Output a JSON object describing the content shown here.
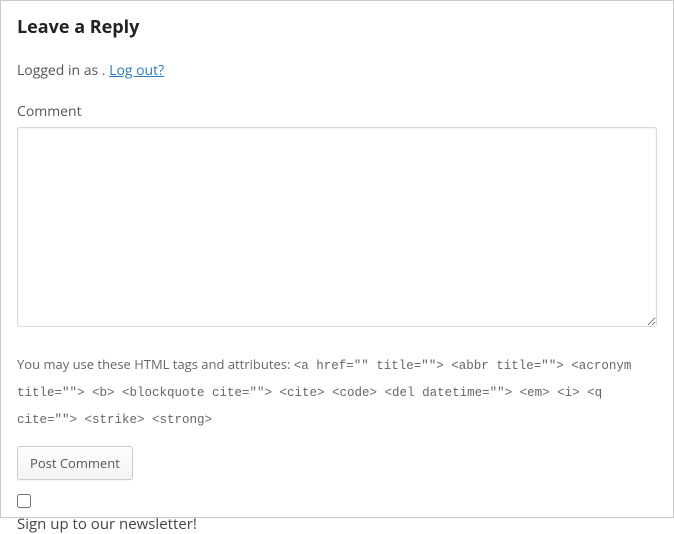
{
  "reply": {
    "title": "Leave a Reply"
  },
  "auth": {
    "logged_in_prefix": "Logged in as ",
    "username": "",
    "separator": ". ",
    "logout_text": "Log out?"
  },
  "comment": {
    "label": "Comment",
    "value": ""
  },
  "allowed_tags": {
    "prefix": "You may use these HTML tags and attributes: ",
    "tags": "<a href=\"\" title=\"\"> <abbr title=\"\"> <acronym title=\"\"> <b> <blockquote cite=\"\"> <cite> <code> <del datetime=\"\"> <em> <i> <q cite=\"\"> <strike> <strong>"
  },
  "submit": {
    "label": "Post Comment"
  },
  "newsletter": {
    "label": "Sign up to our newsletter!",
    "checked": false
  }
}
